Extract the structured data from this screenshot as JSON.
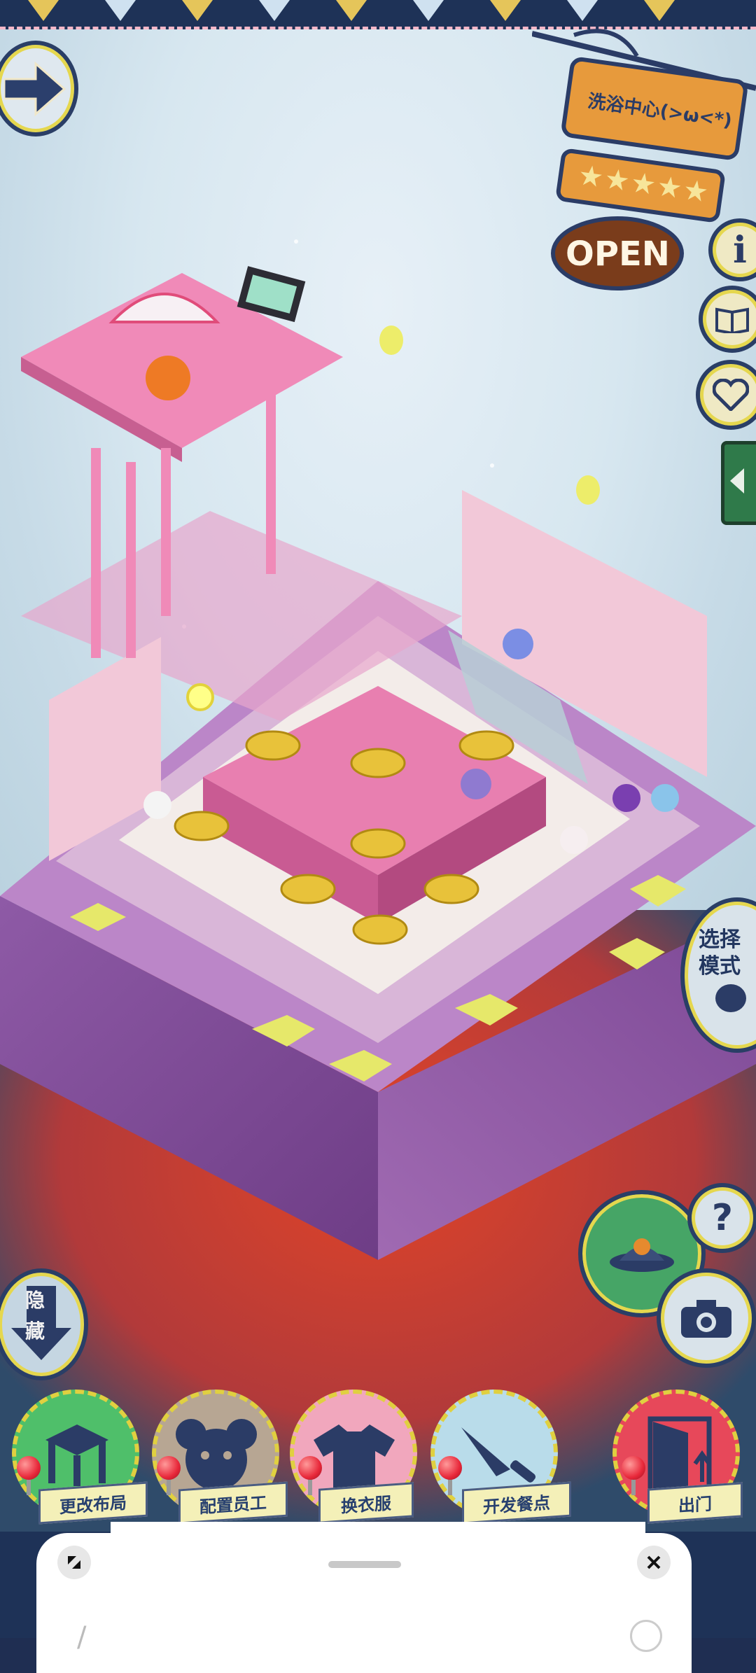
{
  "sign": {
    "shop_name": "洗浴中心(>ω<*)",
    "stars": 5,
    "open_label": "OPEN"
  },
  "side_buttons": {
    "info_icon": "info-icon",
    "book_icon": "book-icon",
    "heart_icon": "heart-icon",
    "select_mode_label": "选择模式",
    "help_label": "?",
    "hide_label": "隐藏"
  },
  "menu": [
    {
      "id": "layout",
      "label": "更改布局",
      "icon": "table-icon",
      "color": "#4fbf6a"
    },
    {
      "id": "staff",
      "label": "配置员工",
      "icon": "bear-head-icon",
      "color": "#b7a693"
    },
    {
      "id": "outfit",
      "label": "换衣服",
      "icon": "shirt-icon",
      "color": "#f1a7bd"
    },
    {
      "id": "menu_dev",
      "label": "开发餐点",
      "icon": "knife-icon",
      "color": "#b9dcea"
    },
    {
      "id": "exit",
      "label": "出门",
      "icon": "door-icon",
      "color": "#e7485a"
    }
  ],
  "sheet": {
    "expand_icon": "expand-icon",
    "close_icon": "close-icon"
  }
}
